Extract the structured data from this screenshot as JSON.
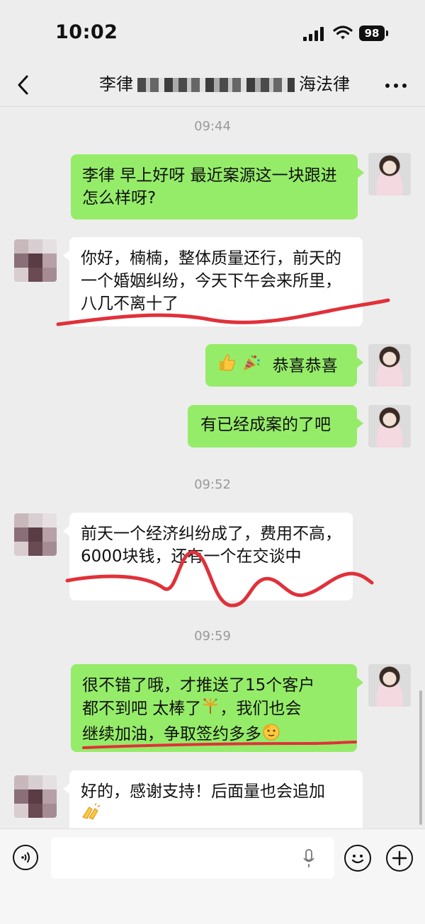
{
  "status_bar": {
    "time": "10:02",
    "battery": "98"
  },
  "nav": {
    "title_prefix": "李律",
    "title_suffix": "海法律"
  },
  "messages": [
    {
      "type": "time",
      "text": "09:44"
    },
    {
      "type": "msg",
      "sender": "me",
      "text": "李律 早上好呀 最近案源这一块跟进怎么样呀?"
    },
    {
      "type": "msg",
      "sender": "other",
      "text": "你好，楠楠，整体质量还行，前天的一个婚姻纠纷，今天下午会来所里，八几不离十了"
    },
    {
      "type": "msg",
      "sender": "me",
      "text": "恭喜恭喜",
      "emojis": [
        "thumbs-up-emoji",
        "party-popper-emoji"
      ]
    },
    {
      "type": "msg",
      "sender": "me",
      "text": "有已经成案的了吧"
    },
    {
      "type": "time",
      "text": "09:52"
    },
    {
      "type": "msg",
      "sender": "other",
      "text": "前天一个经济纠纷成了，费用不高，6000块钱，还有一个在交谈中"
    },
    {
      "type": "time",
      "text": "09:59"
    },
    {
      "type": "msg",
      "sender": "me",
      "line1": "很不错了哦，才推送了15个客户",
      "line2a": "都不到吧  太棒了",
      "line2b": "，我们也会",
      "line3": "继续加油，争取签约多多",
      "emojis": [
        "fireworks-emoji",
        "salute-face-emoji"
      ]
    },
    {
      "type": "msg",
      "sender": "other",
      "text": "好的，感谢支持！后面量也会追加",
      "emojis": [
        "applause-emoji"
      ]
    }
  ],
  "input_bar": {
    "placeholder": ""
  },
  "colors": {
    "my_bubble": "#95ec69",
    "other_bubble": "#ffffff",
    "background": "#ededed",
    "annotation": "#e0313a"
  }
}
